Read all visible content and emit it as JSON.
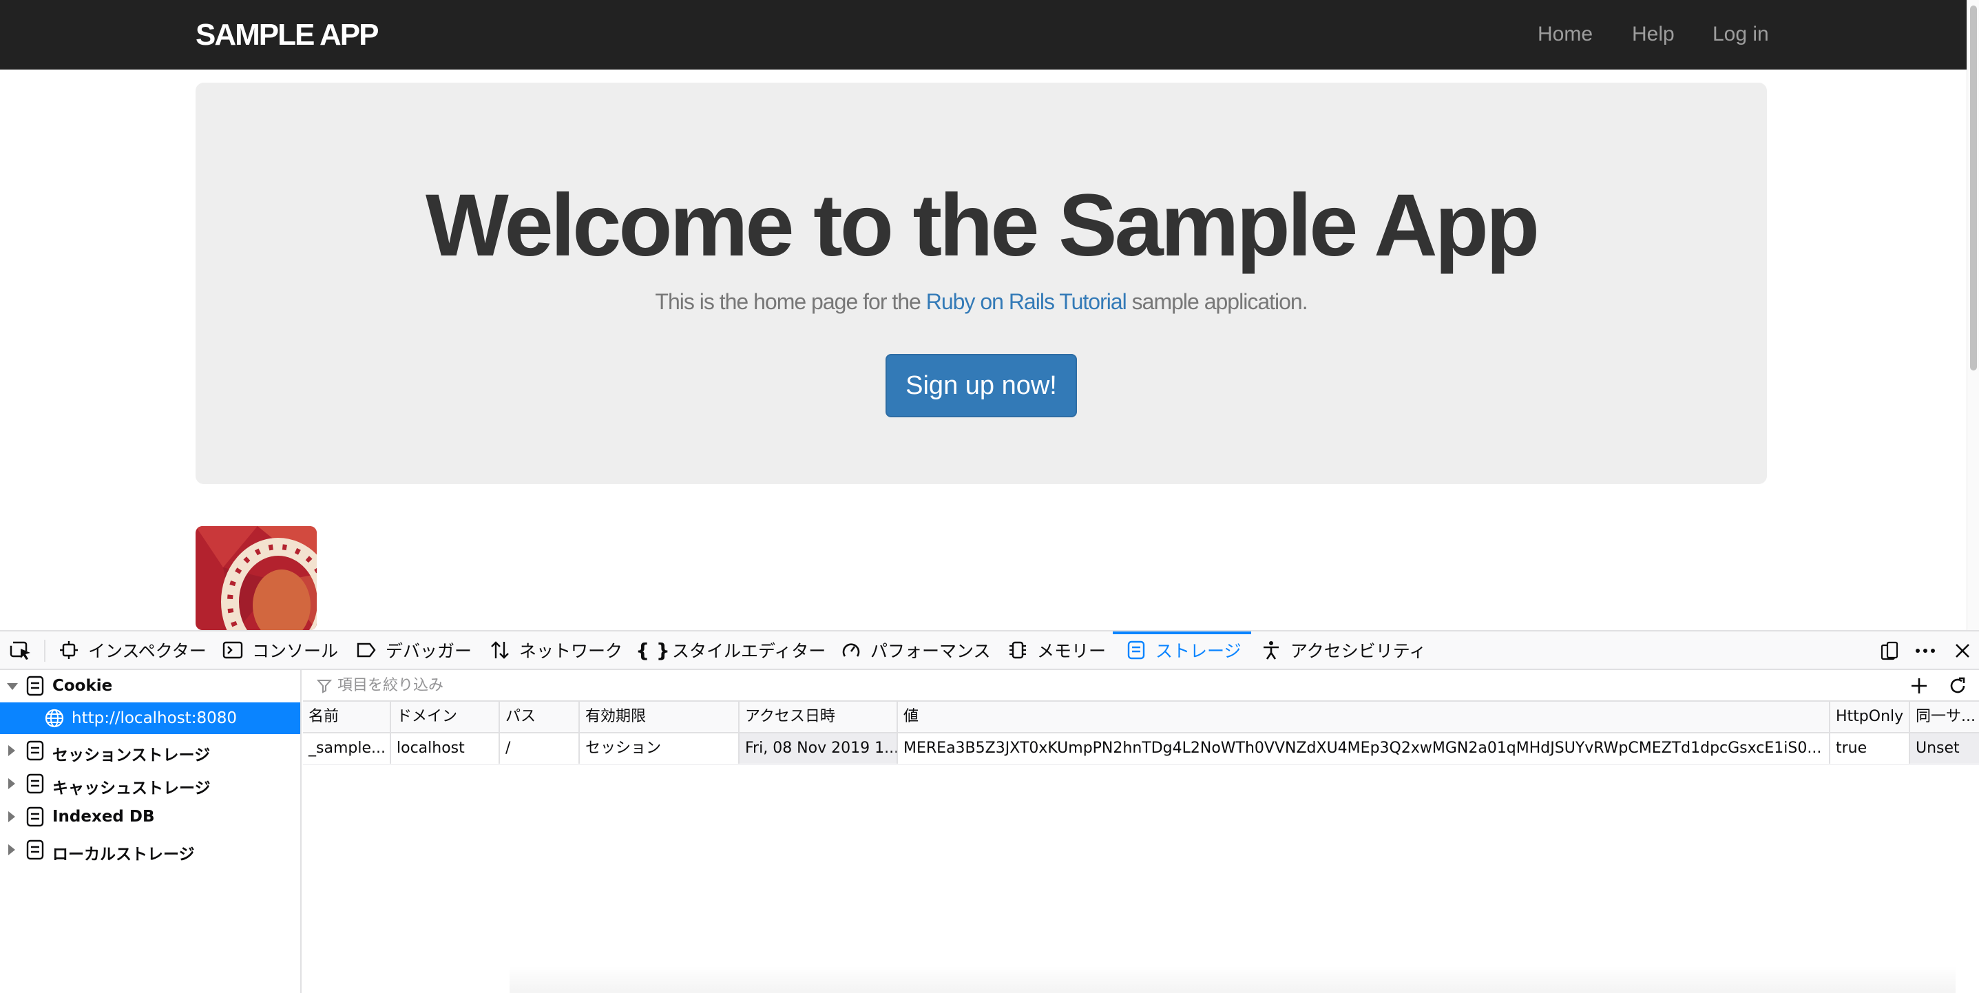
{
  "page": {
    "brand": "SAMPLE APP",
    "nav": [
      "Home",
      "Help",
      "Log in"
    ],
    "hero_title": "Welcome to the Sample App",
    "hero_text_before": "This is the home page for the ",
    "hero_link": "Ruby on Rails Tutorial",
    "hero_text_after": " sample application.",
    "signup_button": "Sign up now!",
    "colors": {
      "navbar": "#222222",
      "jumbotron": "#eeeeee",
      "primary": "#337ab7"
    }
  },
  "devtools": {
    "tabs": [
      {
        "label": "インスペクター",
        "icon": "inspector-icon"
      },
      {
        "label": "コンソール",
        "icon": "console-icon"
      },
      {
        "label": "デバッガー",
        "icon": "debugger-icon"
      },
      {
        "label": "ネットワーク",
        "icon": "network-icon"
      },
      {
        "label": "スタイルエディター",
        "icon": "style-editor-icon"
      },
      {
        "label": "パフォーマンス",
        "icon": "performance-icon"
      },
      {
        "label": "メモリー",
        "icon": "memory-icon"
      },
      {
        "label": "ストレージ",
        "icon": "storage-icon",
        "active": true
      },
      {
        "label": "アクセシビリティ",
        "icon": "accessibility-icon"
      }
    ],
    "sidebar": [
      {
        "label": "Cookie",
        "expanded": true
      },
      {
        "label": "http://localhost:8080",
        "selected": true
      },
      {
        "label": "セッションストレージ"
      },
      {
        "label": "キャッシュストレージ"
      },
      {
        "label": "Indexed DB"
      },
      {
        "label": "ローカルストレージ"
      }
    ],
    "filter_placeholder": "項目を絞り込み",
    "columns": [
      "名前",
      "ドメイン",
      "パス",
      "有効期限",
      "アクセス日時",
      "値",
      "HttpOnly",
      "同一サ..."
    ],
    "rows": [
      [
        "_sample...",
        "localhost",
        "/",
        "セッション",
        "Fri, 08 Nov 2019 1...",
        "MEREa3B5Z3JXT0xKUmpPN2hnTDg4L2NoWTh0VVNZdXU4MEp3Q2xwMGN2a01qMHdJSUYvRWpCMEZTd1dpcGsxcE1iS0...",
        "true",
        "Unset"
      ]
    ],
    "accent": "#0a84ff"
  }
}
